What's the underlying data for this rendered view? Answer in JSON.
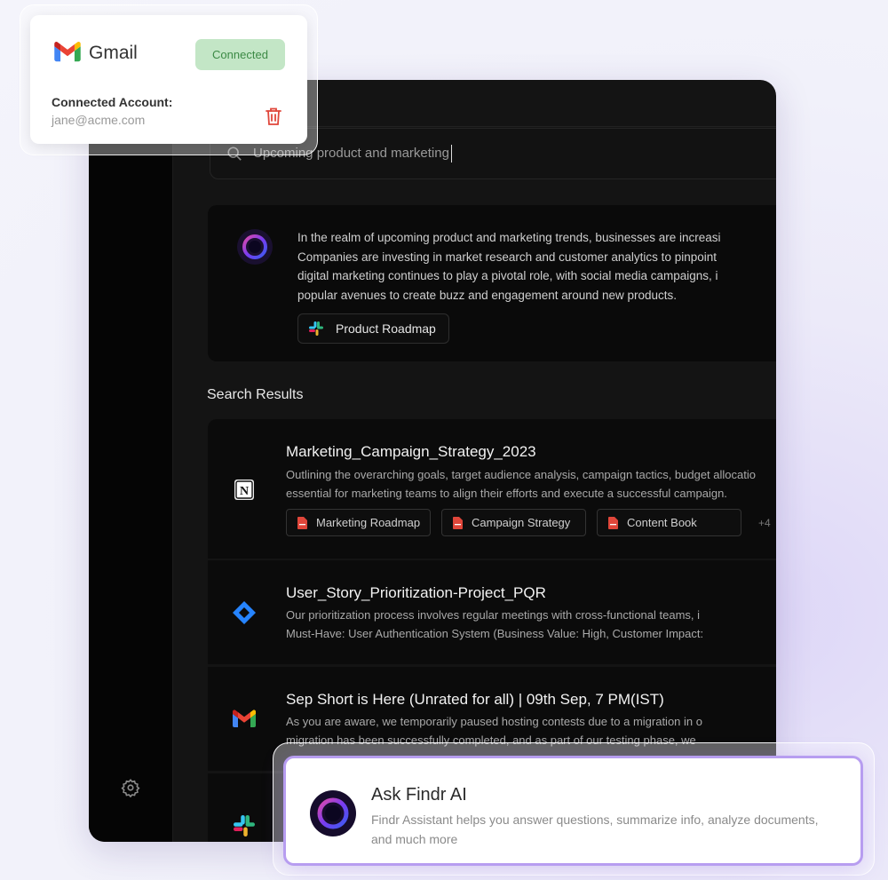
{
  "search": {
    "query": "Upcoming product and marketing"
  },
  "answer": {
    "lines": [
      "In the realm of upcoming product and marketing trends, businesses are increasi",
      "Companies are investing in market research and customer analytics to pinpoint",
      "digital marketing continues to play a pivotal role, with social media campaigns, i",
      "popular avenues to create buzz and engagement around new products."
    ],
    "source_label": "Product Roadmap"
  },
  "results_heading": "Search Results",
  "results": [
    {
      "icon": "notion-icon",
      "title": "Marketing_Campaign_Strategy_2023",
      "desc_lines": [
        "Outlining the overarching goals, target audience analysis, campaign tactics, budget allocatio",
        "essential for marketing teams to align their efforts and execute a successful campaign."
      ],
      "tags": [
        "Marketing Roadmap",
        "Campaign Strategy",
        "Content Book"
      ],
      "more": "+4"
    },
    {
      "icon": "jira-icon",
      "title": "User_Story_Prioritization-Project_PQR",
      "desc_lines": [
        "Our prioritization process involves regular meetings with cross-functional teams, i",
        "Must-Have: User Authentication System (Business Value: High, Customer Impact:"
      ]
    },
    {
      "icon": "gmail-icon",
      "title": "Sep Short is Here (Unrated for all) | 09th Sep, 7 PM(IST)",
      "desc_lines": [
        "As you are aware, we temporarily paused hosting contests due to a migration in o",
        "migration has been successfully completed, and as part of our testing phase, we"
      ]
    },
    {
      "icon": "slack-icon"
    }
  ],
  "gmail_card": {
    "name": "Gmail",
    "status": "Connected",
    "account_label": "Connected Account:",
    "account_email": "jane@acme.com"
  },
  "ask_card": {
    "title": "Ask Findr AI",
    "description": "Findr Assistant helps you answer questions, summarize info, analyze documents, and much more"
  },
  "colors": {
    "accent_purple": "#b79df0",
    "connected_bg": "#c3e6c6",
    "connected_text": "#3c8a45",
    "trash_red": "#e0463a"
  }
}
